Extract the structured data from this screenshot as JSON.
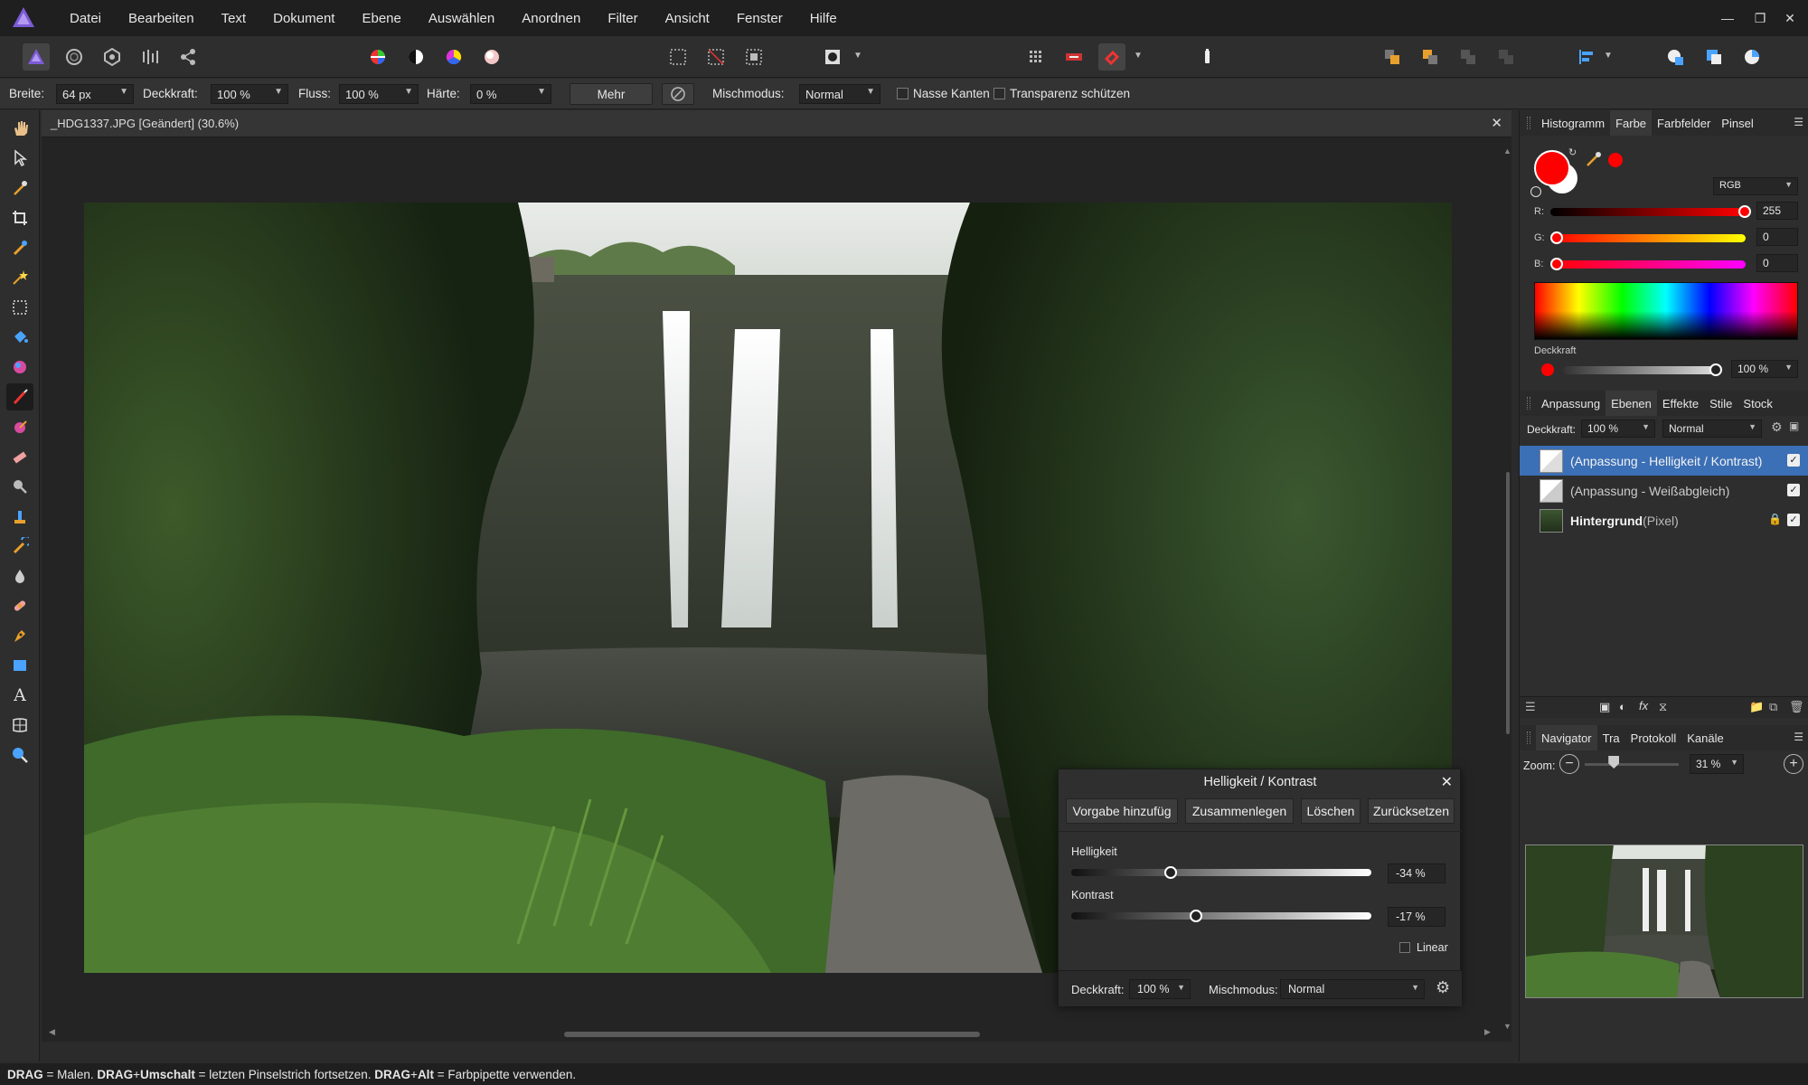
{
  "menubar": {
    "items": [
      "Datei",
      "Bearbeiten",
      "Text",
      "Dokument",
      "Ebene",
      "Auswählen",
      "Anordnen",
      "Filter",
      "Ansicht",
      "Fenster",
      "Hilfe"
    ]
  },
  "contextbar": {
    "breite_label": "Breite:",
    "breite_value": "64 px",
    "deckkraft_label": "Deckkraft:",
    "deckkraft_value": "100 %",
    "fluss_label": "Fluss:",
    "fluss_value": "100 %",
    "haerte_label": "Härte:",
    "haerte_value": "0 %",
    "mehr_label": "Mehr",
    "mischmodus_label": "Mischmodus:",
    "mischmodus_value": "Normal",
    "nasse_kanten_label": "Nasse Kanten",
    "transparenz_label": "Transparenz schützen"
  },
  "document": {
    "tab_title": "_HDG1337.JPG [Geändert] (30.6%)"
  },
  "color_panel": {
    "tabs": [
      "Histogramm",
      "Farbe",
      "Farbfelder",
      "Pinsel"
    ],
    "active_tab": "Farbe",
    "mode": "RGB",
    "r_label": "R:",
    "r_value": "255",
    "g_label": "G:",
    "g_value": "0",
    "b_label": "B:",
    "b_value": "0",
    "opacity_label": "Deckkraft",
    "opacity_value": "100 %",
    "primary_color": "#ff0000",
    "secondary_color": "#ffffff"
  },
  "layers_panel": {
    "tabs": [
      "Anpassung",
      "Ebenen",
      "Effekte",
      "Stile",
      "Stock"
    ],
    "active_tab": "Ebenen",
    "opacity_label": "Deckkraft:",
    "opacity_value": "100 %",
    "blend_value": "Normal",
    "layers": [
      {
        "name": "(Anpassung - Helligkeit / Kontrast)",
        "selected": true
      },
      {
        "name": "(Anpassung - Weißabgleich)",
        "selected": false
      },
      {
        "name_bold": "Hintergrund",
        "name_suffix": " (Pixel)",
        "selected": false
      }
    ]
  },
  "navigator_panel": {
    "tabs": [
      "Navigator",
      "Tra",
      "Protokoll",
      "Kanäle"
    ],
    "active_tab": "Navigator",
    "zoom_label": "Zoom:",
    "zoom_value": "31 %",
    "zoom_fraction": 0.31
  },
  "adjustment_dialog": {
    "title": "Helligkeit / Kontrast",
    "buttons": [
      "Vorgabe hinzufüg",
      "Zusammenlegen",
      "Löschen",
      "Zurücksetzen"
    ],
    "brightness_label": "Helligkeit",
    "brightness_value": "-34 %",
    "brightness_percent": -34,
    "contrast_label": "Kontrast",
    "contrast_value": "-17 %",
    "contrast_percent": -17,
    "linear_label": "Linear",
    "opacity_label": "Deckkraft:",
    "opacity_value": "100 %",
    "blend_label": "Mischmodus:",
    "blend_value": "Normal"
  },
  "statusbar": {
    "k1": "DRAG",
    "t1": " = Malen. ",
    "k2": "DRAG",
    "t2": "+",
    "k3": "Umschalt",
    "t3": " = letzten Pinselstrich fortsetzen. ",
    "k4": "DRAG",
    "t4": "+",
    "k5": "Alt",
    "t5": " = Farbpipette verwenden."
  },
  "icons": {
    "app_logo": "affinity-photo-logo",
    "close": "close-icon",
    "gear": "gear-icon"
  }
}
